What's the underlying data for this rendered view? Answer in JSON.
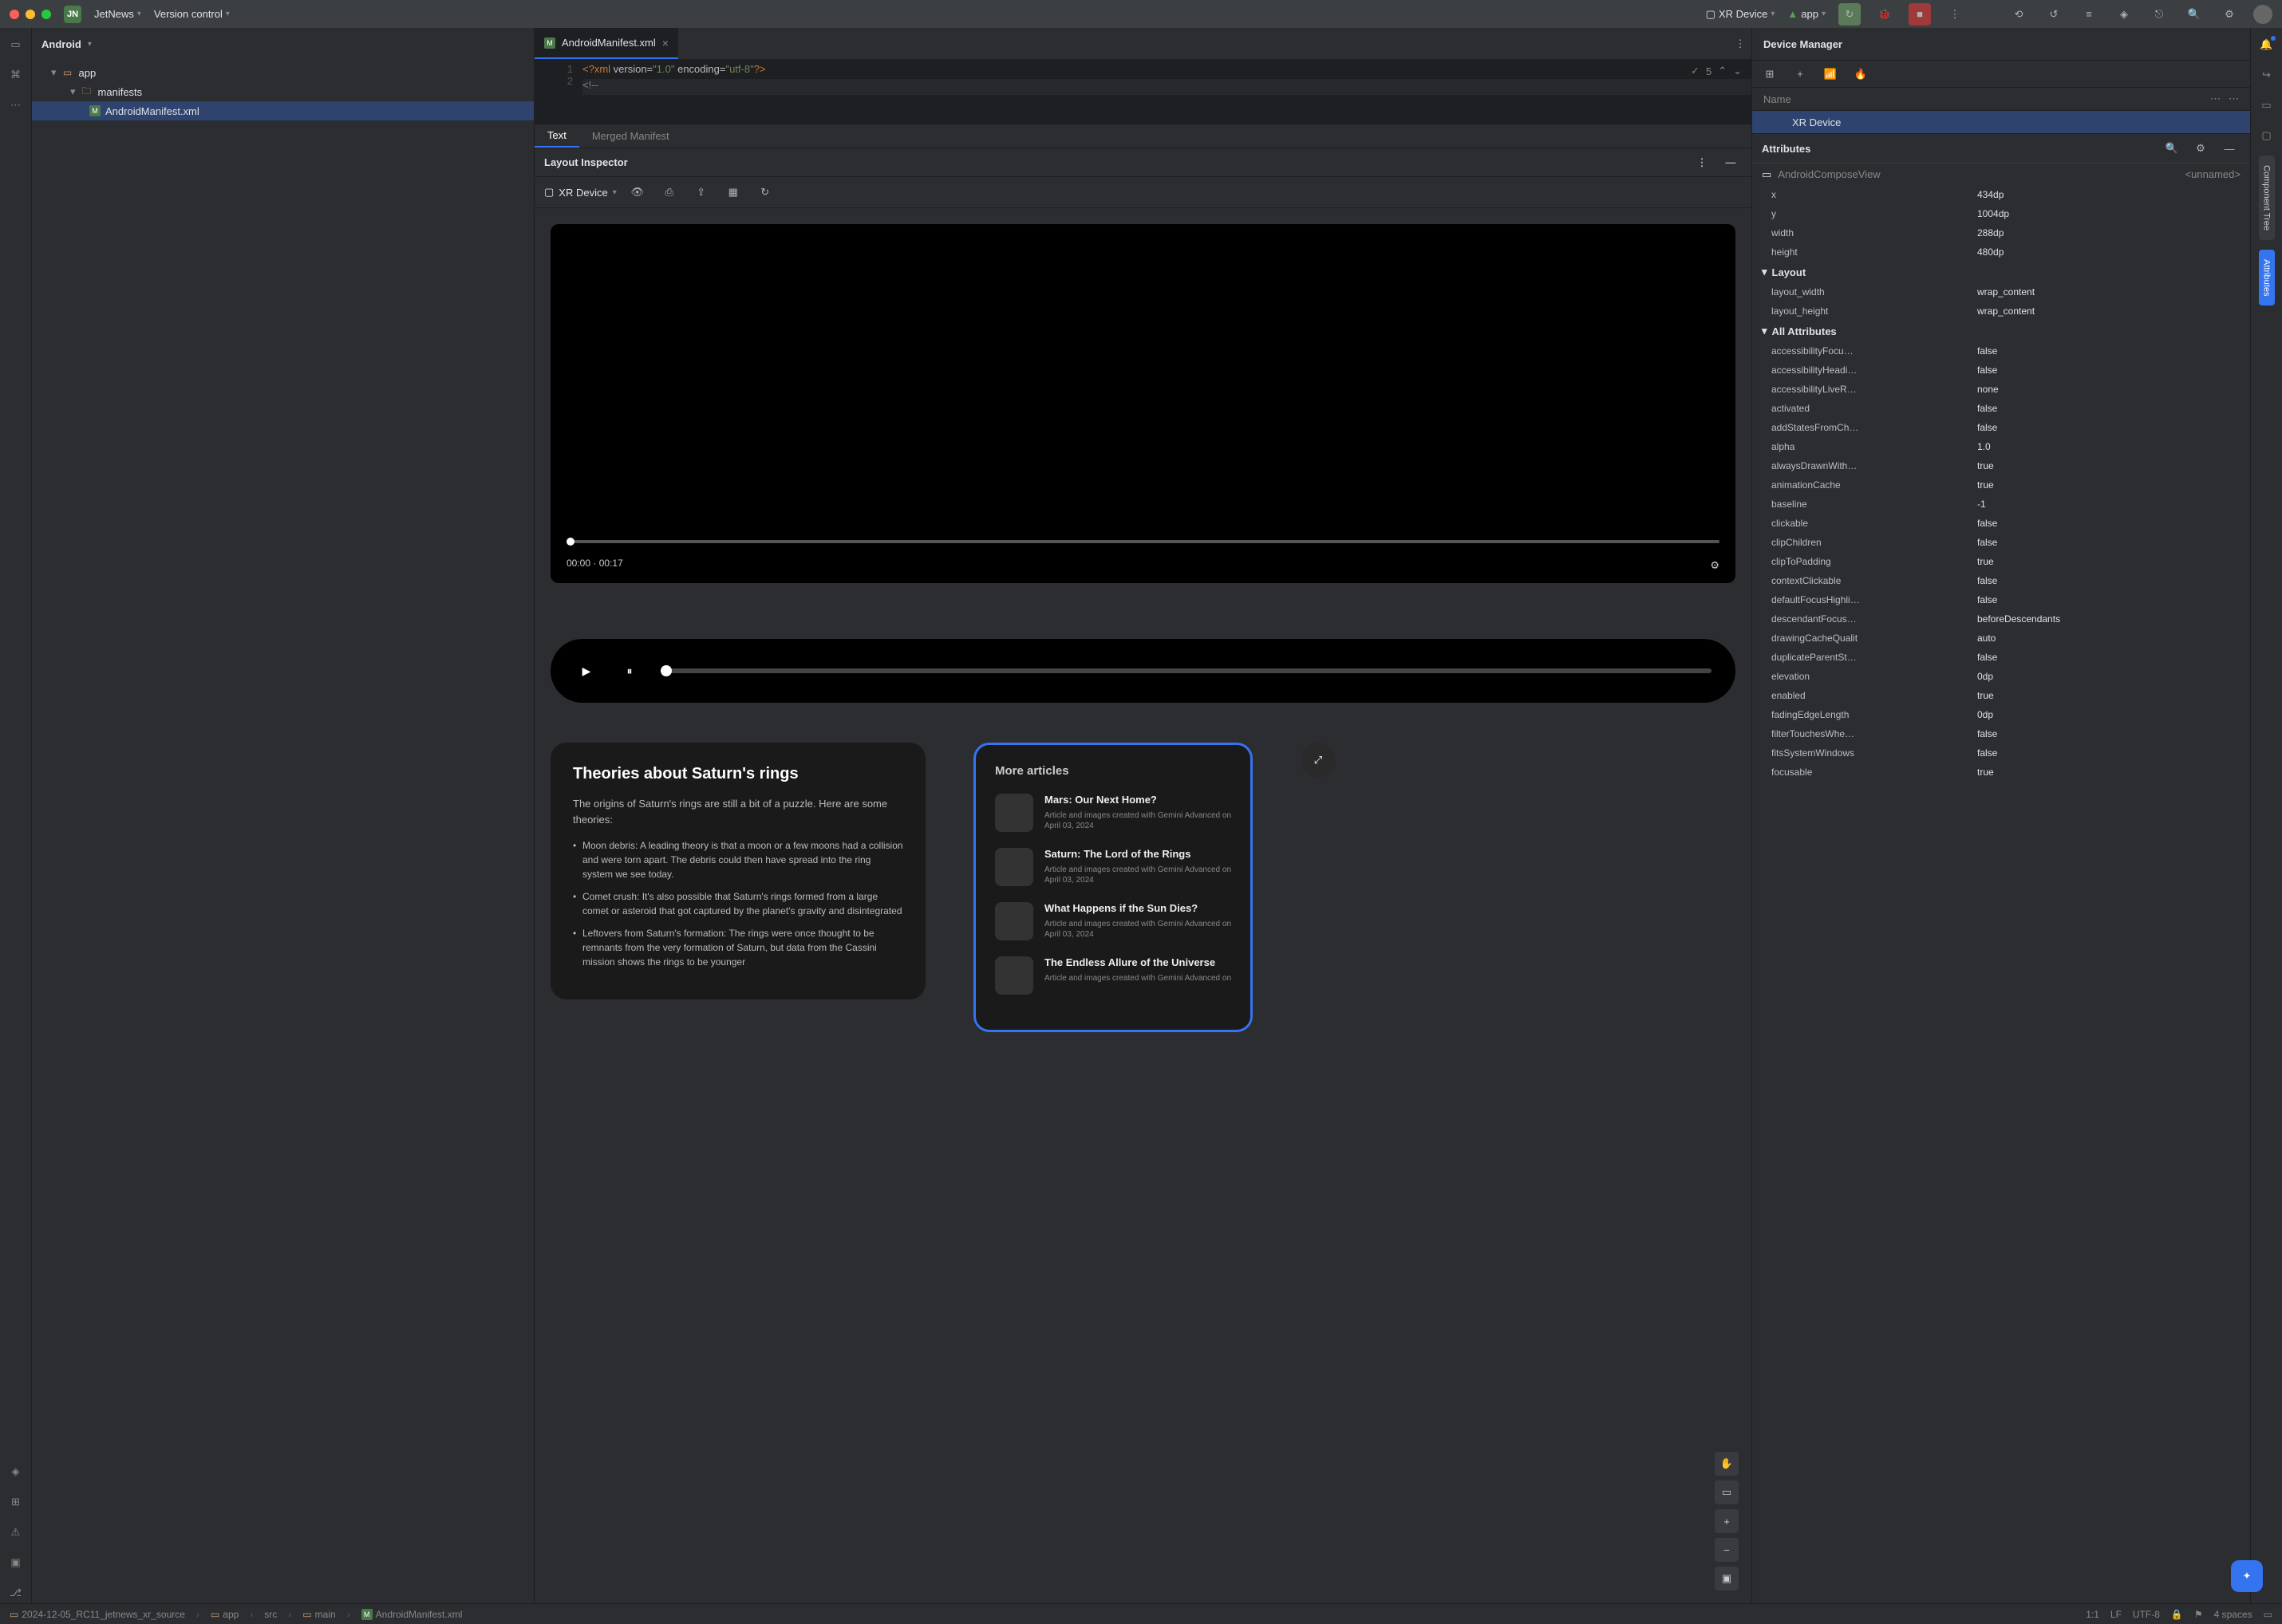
{
  "titlebar": {
    "project_badge": "JN",
    "project_name": "JetNews",
    "vcs": "Version control",
    "run_target_device": "XR Device",
    "run_config": "app"
  },
  "project_panel": {
    "title": "Android",
    "tree": {
      "app": "app",
      "manifests": "manifests",
      "manifest_file": "AndroidManifest.xml"
    }
  },
  "editor": {
    "tab_name": "AndroidManifest.xml",
    "line1_gutter": "1",
    "line2_gutter": "2",
    "line1": "<?xml version=\"1.0\" encoding=\"utf-8\"?>",
    "line2": "<!--",
    "problems_count": "5",
    "subtab_text": "Text",
    "subtab_merged": "Merged Manifest"
  },
  "inspector": {
    "title": "Layout Inspector",
    "device": "XR Device",
    "video": {
      "time_current": "00:00",
      "time_total": "00:17"
    },
    "article": {
      "title": "Theories about Saturn's rings",
      "summary": "The origins of Saturn's rings are still a bit of a puzzle. Here are some theories:",
      "bullet1": "Moon debris: A leading theory is that a moon or a few moons had a collision and were torn apart. The debris could then have spread into the ring system we see today.",
      "bullet2": "Comet crush: It's also possible that Saturn's rings formed from a large comet or asteroid that got captured by the planet's gravity and disintegrated",
      "bullet3": "Leftovers from Saturn's formation: The rings were once thought to be remnants from the very formation of Saturn, but data from the Cassini mission shows the rings to be younger"
    },
    "more": {
      "heading": "More articles",
      "items": [
        {
          "title": "Mars: Our Next Home?",
          "meta": "Article and images created with Gemini Advanced on April 03, 2024"
        },
        {
          "title": "Saturn: The Lord of the Rings",
          "meta": "Article and images created with Gemini Advanced on April 03, 2024"
        },
        {
          "title": "What Happens if the Sun Dies?",
          "meta": "Article and images created with Gemini Advanced on April 03, 2024"
        },
        {
          "title": "The Endless Allure of the Universe",
          "meta": "Article and images created with Gemini Advanced on"
        }
      ]
    }
  },
  "device_manager": {
    "title": "Device Manager",
    "col_name": "Name",
    "device": "XR Device"
  },
  "attributes_panel": {
    "title": "Attributes",
    "component": "AndroidComposeView",
    "unnamed": "<unnamed>",
    "basic": [
      {
        "k": "x",
        "v": "434dp"
      },
      {
        "k": "y",
        "v": "1004dp"
      },
      {
        "k": "width",
        "v": "288dp"
      },
      {
        "k": "height",
        "v": "480dp"
      }
    ],
    "layout_section": "Layout",
    "layout": [
      {
        "k": "layout_width",
        "v": "wrap_content"
      },
      {
        "k": "layout_height",
        "v": "wrap_content"
      }
    ],
    "all_section": "All Attributes",
    "all": [
      {
        "k": "accessibilityFocu…",
        "v": "false"
      },
      {
        "k": "accessibilityHeadi…",
        "v": "false"
      },
      {
        "k": "accessibilityLiveR…",
        "v": "none"
      },
      {
        "k": "activated",
        "v": "false"
      },
      {
        "k": "addStatesFromCh…",
        "v": "false"
      },
      {
        "k": "alpha",
        "v": "1.0"
      },
      {
        "k": "alwaysDrawnWith…",
        "v": "true"
      },
      {
        "k": "animationCache",
        "v": "true"
      },
      {
        "k": "baseline",
        "v": "-1"
      },
      {
        "k": "clickable",
        "v": "false"
      },
      {
        "k": "clipChildren",
        "v": "false"
      },
      {
        "k": "clipToPadding",
        "v": "true"
      },
      {
        "k": "contextClickable",
        "v": "false"
      },
      {
        "k": "defaultFocusHighli…",
        "v": "false"
      },
      {
        "k": "descendantFocus…",
        "v": "beforeDescendants"
      },
      {
        "k": "drawingCacheQualit",
        "v": "auto"
      },
      {
        "k": "duplicateParentSt…",
        "v": "false"
      },
      {
        "k": "elevation",
        "v": "0dp"
      },
      {
        "k": "enabled",
        "v": "true"
      },
      {
        "k": "fadingEdgeLength",
        "v": "0dp"
      },
      {
        "k": "filterTouchesWhe…",
        "v": "false"
      },
      {
        "k": "fitsSystemWindows",
        "v": "false"
      },
      {
        "k": "focusable",
        "v": "true"
      }
    ]
  },
  "right_tabs": {
    "component_tree": "Component Tree",
    "attributes": "Attributes"
  },
  "statusbar": {
    "crumb_root": "2024-12-05_RC11_jetnews_xr_source",
    "crumb_app": "app",
    "crumb_src": "src",
    "crumb_main": "main",
    "crumb_file": "AndroidManifest.xml",
    "cursor": "1:1",
    "line_ending": "LF",
    "encoding": "UTF-8",
    "indent": "4 spaces"
  }
}
